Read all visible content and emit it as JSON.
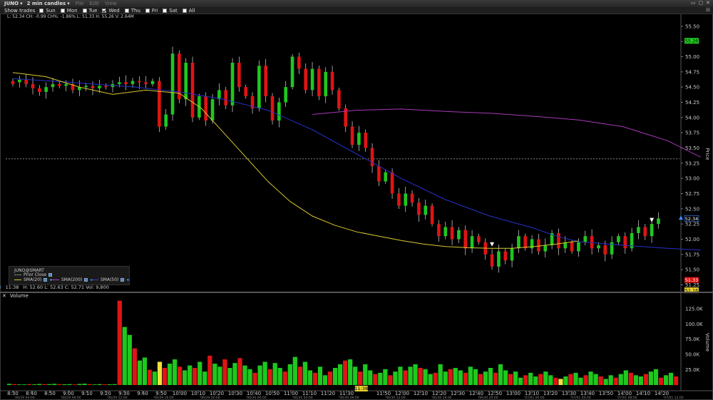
{
  "titlebar": {
    "symbol": "JUNO",
    "interval": "2 min candles",
    "menus": [
      "File",
      "Edit",
      "View"
    ],
    "win_buttons": [
      "▭",
      "▢",
      "✕"
    ]
  },
  "toolbar": {
    "show_trades": "Show trades",
    "days": [
      {
        "label": "Sun",
        "checked": false
      },
      {
        "label": "Mon",
        "checked": false
      },
      {
        "label": "Tue",
        "checked": false
      },
      {
        "label": "Wed",
        "checked": true
      },
      {
        "label": "Thu",
        "checked": false
      },
      {
        "label": "Fri",
        "checked": false
      },
      {
        "label": "Sat",
        "checked": false
      },
      {
        "label": "All",
        "checked": false
      }
    ]
  },
  "info_line": "L: 52.34 CH: -0.99 CH%: -1.86% L: 51.33 H: 55.26 V: 2.64M",
  "hover": {
    "time": "11:38",
    "text": "H: 52.60  L: 52.63  C: 52.71  Vol: 9,800"
  },
  "legend": {
    "title": "JUNO@SMART",
    "rows": [
      {
        "label": "Prior Close",
        "color": "#888888"
      },
      {
        "label": "SMA(20)",
        "color": "#d8c830"
      },
      {
        "label": "SMA(200)",
        "color": "#b040c0"
      },
      {
        "label": "SMA(50)",
        "color": "#3040d0"
      }
    ]
  },
  "volume_pane": {
    "title": "Volume"
  },
  "colors": {
    "up": "#1ec81e",
    "down": "#e01414",
    "sma20": "#d8c830",
    "sma50": "#2830c8",
    "sma200": "#a838b8",
    "prior": "#9a9a9a"
  },
  "chart_data": {
    "type": "candlestick",
    "price_axis": {
      "label": "Price",
      "ticks": [
        55.5,
        55.25,
        55.0,
        54.75,
        54.5,
        54.25,
        54.0,
        53.75,
        53.5,
        53.25,
        53.0,
        52.75,
        52.5,
        52.25,
        52.0,
        51.75,
        51.5,
        51.25
      ],
      "range": [
        51.15,
        55.65
      ]
    },
    "volume_axis": {
      "label": "Volume",
      "ticks": [
        "125.0K",
        "100.0K",
        "75.0K",
        "50.0K",
        "25.0K"
      ],
      "tick_values": [
        125000,
        100000,
        75000,
        50000,
        25000
      ],
      "range": [
        0,
        140000
      ]
    },
    "time_ticks": [
      "8:30",
      "8:40",
      "8:50",
      "9:00",
      "9:10",
      "9:20",
      "9:30",
      "9:40",
      "9:50",
      "10:00",
      "10:10",
      "10:20",
      "10:30",
      "10:40",
      "10:50",
      "11:00",
      "11:10",
      "11:20",
      "11:30",
      "11:50",
      "12:00",
      "12:10",
      "12:20",
      "12:30",
      "12:40",
      "12:50",
      "13:00",
      "13:10",
      "13:20",
      "13:30",
      "13:40",
      "13:50",
      "14:00",
      "14:10",
      "14:20"
    ],
    "time_tick_minutes": [
      510,
      520,
      530,
      540,
      550,
      560,
      570,
      580,
      590,
      600,
      610,
      620,
      630,
      640,
      650,
      660,
      670,
      680,
      690,
      710,
      720,
      730,
      740,
      750,
      760,
      770,
      780,
      790,
      800,
      810,
      820,
      830,
      840,
      850,
      860
    ],
    "time_highlight": "11:38",
    "date_labels": [
      "'06/29 04:00",
      "'06/29 08:00",
      "'06/29 12:00",
      "'06/29 16:00",
      "'06/29 20:00",
      "'06/30 00:00",
      "'06/30 04:00",
      "'06/30 08:00",
      "'06/30 12:00",
      "'06/30 16:00",
      "'06/30 20:00",
      "'07/01 00:00",
      "'07/01 04:00",
      "'07/01 08:00",
      "'07/01 12:00"
    ],
    "prior_close": 53.32,
    "price_tags": [
      {
        "value": 55.26,
        "text": "55.26",
        "bg": "#22cc22",
        "fg": "#000000"
      },
      {
        "value": 52.34,
        "text": "52.34",
        "bg": "#000000",
        "fg": "#ffffff",
        "border": "#4488ff"
      },
      {
        "value": 51.33,
        "text": "51.33",
        "bg": "#dd1111",
        "fg": "#ffffff"
      },
      {
        "value": 51.16,
        "text": "51.16",
        "bg": "#e8d030",
        "fg": "#000000"
      }
    ],
    "sma20": [
      [
        510,
        54.74
      ],
      [
        540,
        54.67
      ],
      [
        570,
        54.5
      ],
      [
        600,
        54.38
      ],
      [
        630,
        54.45
      ],
      [
        660,
        54.4
      ],
      [
        680,
        54.15
      ],
      [
        700,
        53.75
      ],
      [
        720,
        53.35
      ],
      [
        740,
        52.95
      ],
      [
        760,
        52.62
      ],
      [
        780,
        52.38
      ],
      [
        800,
        52.23
      ],
      [
        820,
        52.12
      ],
      [
        840,
        52.05
      ],
      [
        860,
        51.98
      ],
      [
        880,
        51.92
      ],
      [
        900,
        51.88
      ],
      [
        920,
        51.86
      ],
      [
        940,
        51.85
      ],
      [
        960,
        51.85
      ],
      [
        980,
        51.88
      ],
      [
        1000,
        51.92
      ],
      [
        1020,
        51.97
      ]
    ],
    "sma50": [
      [
        510,
        54.64
      ],
      [
        560,
        54.58
      ],
      [
        620,
        54.5
      ],
      [
        660,
        54.42
      ],
      [
        700,
        54.3
      ],
      [
        740,
        54.12
      ],
      [
        780,
        53.8
      ],
      [
        820,
        53.4
      ],
      [
        860,
        53.0
      ],
      [
        900,
        52.65
      ],
      [
        940,
        52.38
      ],
      [
        980,
        52.18
      ],
      [
        1000,
        52.05
      ],
      [
        1020,
        51.96
      ],
      [
        1060,
        51.9
      ],
      [
        1100,
        51.85
      ],
      [
        1130,
        51.82
      ]
    ],
    "sma200": [
      [
        780,
        54.05
      ],
      [
        820,
        54.12
      ],
      [
        860,
        54.14
      ],
      [
        900,
        54.1
      ],
      [
        940,
        54.07
      ],
      [
        980,
        54.02
      ],
      [
        1020,
        53.96
      ],
      [
        1060,
        53.85
      ],
      [
        1100,
        53.62
      ],
      [
        1130,
        53.35
      ]
    ],
    "candles": [
      [
        510,
        54.6,
        54.55
      ],
      [
        516,
        54.58,
        54.62
      ],
      [
        522,
        54.62,
        54.55
      ],
      [
        528,
        54.55,
        54.48
      ],
      [
        534,
        54.48,
        54.42
      ],
      [
        540,
        54.42,
        54.5
      ],
      [
        546,
        54.5,
        54.55
      ],
      [
        552,
        54.55,
        54.52
      ],
      [
        558,
        54.52,
        54.55
      ],
      [
        564,
        54.55,
        54.45
      ],
      [
        570,
        54.45,
        54.5
      ],
      [
        576,
        54.5,
        54.52
      ],
      [
        582,
        54.52,
        54.48
      ],
      [
        588,
        54.48,
        54.52
      ],
      [
        594,
        54.52,
        54.5
      ],
      [
        600,
        54.5,
        54.55
      ],
      [
        606,
        54.55,
        54.58
      ],
      [
        612,
        54.58,
        54.55
      ],
      [
        618,
        54.55,
        54.6
      ],
      [
        624,
        54.6,
        54.58
      ],
      [
        630,
        54.58,
        54.55
      ],
      [
        636,
        54.55,
        54.6
      ],
      [
        642,
        54.6,
        53.85
      ],
      [
        648,
        53.85,
        54.05
      ],
      [
        654,
        54.05,
        55.05
      ],
      [
        660,
        55.05,
        54.3
      ],
      [
        666,
        54.3,
        54.9
      ],
      [
        672,
        54.9,
        54.0
      ],
      [
        678,
        54.0,
        54.35
      ],
      [
        684,
        54.35,
        53.95
      ],
      [
        690,
        53.95,
        54.3
      ],
      [
        696,
        54.3,
        54.45
      ],
      [
        702,
        54.45,
        54.2
      ],
      [
        708,
        54.2,
        54.9
      ],
      [
        714,
        54.9,
        54.5
      ],
      [
        720,
        54.5,
        54.35
      ],
      [
        726,
        54.35,
        54.15
      ],
      [
        732,
        54.15,
        54.85
      ],
      [
        738,
        54.85,
        54.35
      ],
      [
        744,
        54.35,
        53.95
      ],
      [
        750,
        53.95,
        54.25
      ],
      [
        756,
        54.25,
        54.5
      ],
      [
        762,
        54.5,
        55.0
      ],
      [
        768,
        55.0,
        54.8
      ],
      [
        774,
        54.8,
        54.45
      ],
      [
        780,
        54.45,
        54.8
      ],
      [
        786,
        54.8,
        54.35
      ],
      [
        792,
        54.35,
        54.75
      ],
      [
        798,
        54.75,
        54.45
      ],
      [
        804,
        54.45,
        54.15
      ],
      [
        810,
        54.15,
        53.85
      ],
      [
        816,
        53.85,
        53.55
      ],
      [
        822,
        53.55,
        53.75
      ],
      [
        828,
        53.75,
        53.5
      ],
      [
        834,
        53.5,
        53.2
      ],
      [
        840,
        53.2,
        52.95
      ],
      [
        846,
        52.95,
        53.1
      ],
      [
        852,
        53.1,
        52.75
      ],
      [
        858,
        52.75,
        52.55
      ],
      [
        864,
        52.55,
        52.75
      ],
      [
        870,
        52.75,
        52.6
      ],
      [
        876,
        52.6,
        52.4
      ],
      [
        882,
        52.4,
        52.55
      ],
      [
        888,
        52.55,
        52.25
      ],
      [
        894,
        52.25,
        52.05
      ],
      [
        900,
        52.05,
        52.2
      ],
      [
        906,
        52.2,
        52.0
      ],
      [
        912,
        52.0,
        52.15
      ],
      [
        918,
        52.15,
        51.85
      ],
      [
        924,
        51.85,
        52.05
      ],
      [
        930,
        52.05,
        51.95
      ],
      [
        936,
        51.95,
        51.75
      ],
      [
        942,
        51.75,
        51.55
      ],
      [
        948,
        51.55,
        51.8
      ],
      [
        954,
        51.8,
        51.65
      ],
      [
        960,
        51.65,
        51.85
      ],
      [
        966,
        51.85,
        52.05
      ],
      [
        972,
        52.05,
        51.85
      ],
      [
        978,
        51.85,
        52.0
      ],
      [
        984,
        52.0,
        51.8
      ],
      [
        990,
        51.8,
        51.9
      ],
      [
        996,
        51.9,
        52.1
      ],
      [
        1002,
        52.1,
        51.85
      ],
      [
        1008,
        51.85,
        51.95
      ],
      [
        1014,
        51.95,
        51.8
      ],
      [
        1020,
        51.8,
        51.95
      ],
      [
        1026,
        51.95,
        52.05
      ],
      [
        1032,
        52.05,
        51.85
      ],
      [
        1038,
        51.85,
        51.9
      ],
      [
        1044,
        51.9,
        51.75
      ],
      [
        1050,
        51.75,
        51.95
      ],
      [
        1056,
        51.95,
        52.05
      ],
      [
        1062,
        52.05,
        51.85
      ],
      [
        1068,
        51.85,
        52.1
      ],
      [
        1074,
        52.1,
        52.2
      ],
      [
        1080,
        52.2,
        52.05
      ],
      [
        1086,
        52.05,
        52.25
      ],
      [
        1092,
        52.25,
        52.34
      ]
    ],
    "candle_minute_scale": {
      "from": [
        510,
        1092
      ],
      "to_ticks": [
        510,
        860
      ]
    },
    "volume": [
      2000,
      1500,
      1000,
      1000,
      1500,
      1200,
      1800,
      1400,
      1500,
      2000,
      1500,
      1200,
      1500,
      1000,
      1800,
      2200,
      1500,
      1000,
      1500,
      1200,
      1200,
      1500,
      138000,
      95000,
      82000,
      60000,
      40000,
      45000,
      25000,
      22000,
      38000,
      28000,
      35000,
      42000,
      30000,
      24000,
      32000,
      28000,
      38000,
      22000,
      48000,
      35000,
      30000,
      42000,
      28000,
      36000,
      44000,
      32000,
      26000,
      20000,
      32000,
      38000,
      26000,
      36000,
      28000,
      22000,
      34000,
      46000,
      30000,
      38000,
      24000,
      20000,
      30000,
      16000,
      22000,
      28000,
      34000,
      40000,
      42000,
      30000,
      22000,
      34000,
      24000,
      18000,
      20000,
      26000,
      16000,
      22000,
      30000,
      24000,
      30000,
      34000,
      28000,
      26000,
      18000,
      20000,
      34000,
      22000,
      26000,
      28000,
      24000,
      20000,
      30000,
      26000,
      18000,
      22000,
      28000,
      20000,
      34000,
      24000,
      18000,
      22000,
      12000,
      16000,
      20000,
      14000,
      18000,
      22000,
      16000,
      12000,
      10000,
      14000,
      18000,
      20000,
      12000,
      16000,
      22000,
      18000,
      14000,
      10000,
      16000,
      12000,
      18000,
      24000,
      20000,
      16000,
      14000,
      18000,
      22000,
      26000,
      12000,
      16000,
      20000,
      14000
    ]
  }
}
